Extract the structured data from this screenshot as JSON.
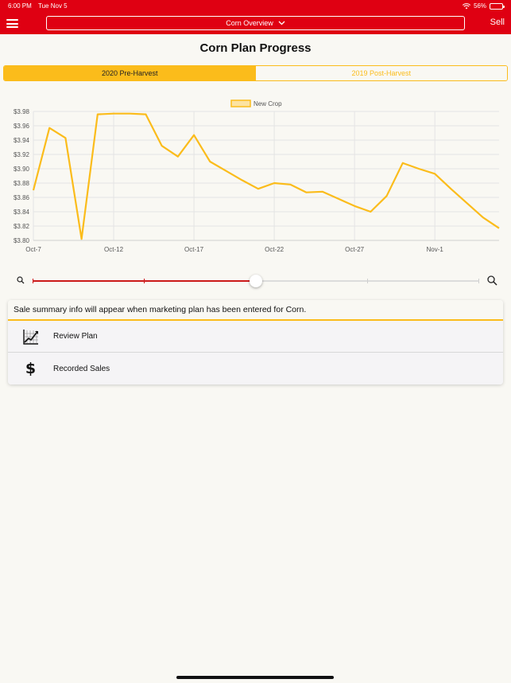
{
  "status_bar": {
    "time": "6:00 PM",
    "date": "Tue Nov 5",
    "battery": "56%",
    "battery_level": 0.56
  },
  "header": {
    "title": "Corn Overview",
    "sell_label": "Sell"
  },
  "page_title": "Corn Plan Progress",
  "tabs": [
    {
      "label": "2020 Pre-Harvest",
      "active": true
    },
    {
      "label": "2019 Post-Harvest",
      "active": false
    }
  ],
  "colors": {
    "brand_red": "#df0012",
    "accent_yellow": "#fbbc1b",
    "slider_red": "#cc1a1a"
  },
  "chart_data": {
    "type": "line",
    "legend_position": "top",
    "grid": true,
    "series": [
      {
        "name": "New Crop",
        "color": "#fbbc1b",
        "x": [
          0,
          1,
          2,
          3,
          4,
          5,
          6,
          7,
          8,
          9,
          10,
          11,
          12,
          13,
          14,
          15,
          16,
          17,
          18,
          19,
          20,
          21,
          22,
          23,
          24,
          25,
          26,
          27,
          28,
          29
        ],
        "values": [
          3.87,
          3.957,
          3.943,
          3.802,
          3.976,
          3.977,
          3.977,
          3.976,
          3.932,
          3.917,
          3.947,
          3.91,
          3.897,
          3.884,
          3.872,
          3.88,
          3.878,
          3.867,
          3.868,
          3.858,
          3.848,
          3.84,
          3.862,
          3.908,
          3.9,
          3.893,
          3.872,
          3.852,
          3.832,
          3.817
        ]
      }
    ],
    "x_ticks": [
      {
        "x": 0,
        "label": "Oct-7"
      },
      {
        "x": 5,
        "label": "Oct-12"
      },
      {
        "x": 10,
        "label": "Oct-17"
      },
      {
        "x": 15,
        "label": "Oct-22"
      },
      {
        "x": 20,
        "label": "Oct-27"
      },
      {
        "x": 25,
        "label": "Nov-1"
      }
    ],
    "y_ticks": [
      "$3.80",
      "$3.82",
      "$3.84",
      "$3.86",
      "$3.88",
      "$3.90",
      "$3.92",
      "$3.94",
      "$3.96",
      "$3.98"
    ],
    "ylim": [
      3.8,
      3.98
    ],
    "xlim": [
      0,
      29
    ]
  },
  "slider": {
    "value": 0.5,
    "ticks": [
      0,
      0.25,
      0.75,
      1
    ]
  },
  "summary": {
    "info_text": "Sale summary info will appear when marketing plan has been entered for Corn.",
    "items": [
      {
        "label": "Review Plan",
        "icon": "chart-icon"
      },
      {
        "label": "Recorded Sales",
        "icon": "dollar-icon"
      }
    ]
  }
}
